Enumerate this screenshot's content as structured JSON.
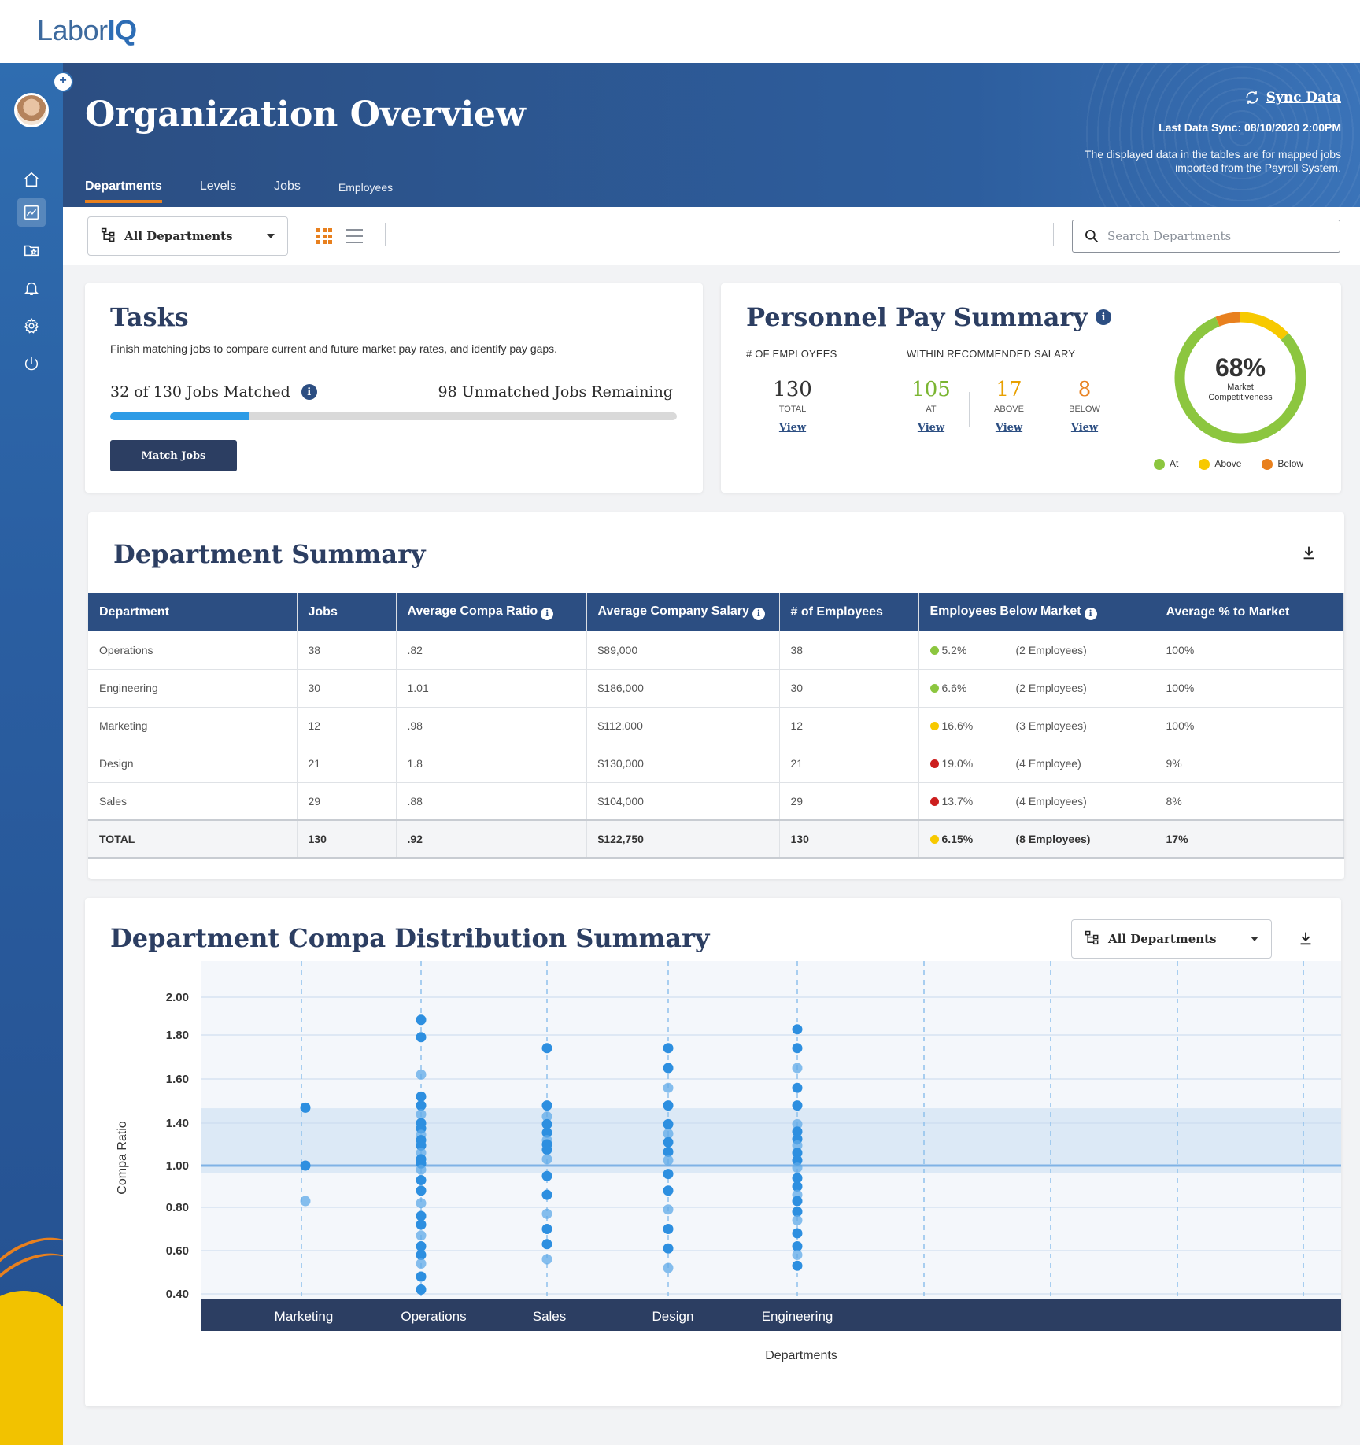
{
  "brand": {
    "logo_light": "Labor",
    "logo_bold": "IQ"
  },
  "sidebar": {
    "items": [
      {
        "name": "home-icon"
      },
      {
        "name": "chart-icon",
        "active": true
      },
      {
        "name": "folder-star-icon"
      },
      {
        "name": "bell-icon"
      },
      {
        "name": "gear-icon"
      },
      {
        "name": "power-icon"
      }
    ],
    "add_label": "+"
  },
  "header": {
    "title": "Organization Overview",
    "sync_label": "Sync Data",
    "last_sync": "Last Data Sync: 08/10/2020 2:00PM",
    "note": "The displayed data in the tables are for mapped jobs imported from the Payroll System.",
    "tabs": [
      {
        "label": "Departments",
        "active": true
      },
      {
        "label": "Levels"
      },
      {
        "label": "Jobs"
      },
      {
        "label": "Employees"
      }
    ]
  },
  "toolbar": {
    "department_select": "All Departments",
    "search_placeholder": "Search Departments"
  },
  "tasks": {
    "title": "Tasks",
    "description": "Finish matching jobs to compare current and future market pay rates, and identify pay gaps.",
    "matched_label": "32 of 130 Jobs Matched",
    "remaining_label": "98 Unmatched Jobs Remaining",
    "progress_fraction": 0.246,
    "button_label": "Match Jobs"
  },
  "pay_summary": {
    "title": "Personnel Pay Summary",
    "employees_heading": "# OF EMPLOYEES",
    "recommended_heading": "WITHIN RECOMMENDED SALARY",
    "total": {
      "value": "130",
      "caption": "TOTAL",
      "link": "View"
    },
    "at": {
      "value": "105",
      "caption": "AT",
      "link": "View"
    },
    "above": {
      "value": "17",
      "caption": "ABOVE",
      "link": "View"
    },
    "below": {
      "value": "8",
      "caption": "BELOW",
      "link": "View"
    },
    "donut": {
      "percent": "68%",
      "caption": "Market Competitiveness",
      "segments": [
        {
          "label": "At",
          "value": 105,
          "color": "#8cc63f"
        },
        {
          "label": "Above",
          "value": 17,
          "color": "#f7c900"
        },
        {
          "label": "Below",
          "value": 8,
          "color": "#e8801e"
        }
      ]
    },
    "legend": [
      {
        "label": "At",
        "color": "#8cc63f"
      },
      {
        "label": "Above",
        "color": "#f7c900"
      },
      {
        "label": "Below",
        "color": "#e8801e"
      }
    ]
  },
  "department_summary": {
    "title": "Department Summary",
    "columns": [
      "Department",
      "Jobs",
      "Average Compa Ratio",
      "Average Company Salary",
      "# of Employees",
      "Employees Below Market",
      "Average % to Market"
    ],
    "rows": [
      {
        "department": "Operations",
        "jobs": "38",
        "compa": ".82",
        "salary": "$89,000",
        "employees": "38",
        "below_pct": "5.2%",
        "below_color": "#8cc63f",
        "below_count": "(2 Employees)",
        "avg_market": "100%"
      },
      {
        "department": "Engineering",
        "jobs": "30",
        "compa": "1.01",
        "salary": "$186,000",
        "employees": "30",
        "below_pct": "6.6%",
        "below_color": "#8cc63f",
        "below_count": "(2 Employees)",
        "avg_market": "100%"
      },
      {
        "department": "Marketing",
        "jobs": "12",
        "compa": ".98",
        "salary": "$112,000",
        "employees": "12",
        "below_pct": "16.6%",
        "below_color": "#f7c900",
        "below_count": "(3 Employees)",
        "avg_market": "100%"
      },
      {
        "department": "Design",
        "jobs": "21",
        "compa": "1.8",
        "salary": "$130,000",
        "employees": "21",
        "below_pct": "19.0%",
        "below_color": "#cc1e1e",
        "below_count": "(4 Employee)",
        "avg_market": "9%"
      },
      {
        "department": "Sales",
        "jobs": "29",
        "compa": ".88",
        "salary": "$104,000",
        "employees": "29",
        "below_pct": "13.7%",
        "below_color": "#cc1e1e",
        "below_count": "(4 Employees)",
        "avg_market": "8%"
      }
    ],
    "total": {
      "department": "TOTAL",
      "jobs": "130",
      "compa": ".92",
      "salary": "$122,750",
      "employees": "130",
      "below_pct": "6.15%",
      "below_color": "#f7c900",
      "below_count": "(8 Employees)",
      "avg_market": "17%"
    }
  },
  "compa_distribution": {
    "title": "Department Compa Distribution Summary",
    "department_select": "All Departments"
  },
  "chart_data": {
    "type": "scatter",
    "ylabel": "Compa Ratio",
    "xlabel": "Departments",
    "y_ticks": [
      "2.00",
      "1.80",
      "1.60",
      "1.40",
      "1.00",
      "0.80",
      "0.60",
      "0.40"
    ],
    "band": [
      0.86,
      1.14
    ],
    "reference_line": 1.0,
    "categories": [
      "Marketing",
      "Operations",
      "Sales",
      "Design",
      "Engineering"
    ],
    "series": [
      {
        "category": "Marketing",
        "values": [
          1.47,
          1.0,
          0.83
        ]
      },
      {
        "category": "Operations",
        "values": [
          1.88,
          1.79,
          1.62,
          1.52,
          1.48,
          1.44,
          1.4,
          1.35,
          1.29,
          1.24,
          1.19,
          1.12,
          1.06,
          1.02,
          0.98,
          0.93,
          0.88,
          0.82,
          0.76,
          0.72,
          0.67,
          0.62,
          0.58,
          0.54,
          0.48,
          0.42,
          0.33
        ]
      },
      {
        "category": "Sales",
        "values": [
          1.74,
          1.48,
          1.43,
          1.39,
          1.31,
          1.24,
          1.2,
          1.15,
          1.06,
          0.95,
          0.86,
          0.77,
          0.7,
          0.63,
          0.56
        ]
      },
      {
        "category": "Design",
        "values": [
          1.74,
          1.65,
          1.56,
          1.48,
          1.39,
          1.3,
          1.22,
          1.13,
          1.05,
          0.96,
          0.88,
          0.79,
          0.7,
          0.61,
          0.52
        ]
      },
      {
        "category": "Engineering",
        "values": [
          1.83,
          1.74,
          1.65,
          1.56,
          1.48,
          1.39,
          1.32,
          1.25,
          1.19,
          1.12,
          1.05,
          0.99,
          0.94,
          0.9,
          0.86,
          0.83,
          0.78,
          0.74,
          0.68,
          0.62,
          0.58,
          0.53
        ]
      }
    ],
    "point_color": "#2d8fe0",
    "grid": true
  }
}
